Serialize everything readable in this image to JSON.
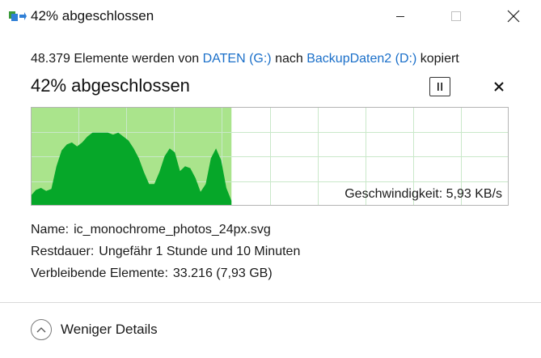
{
  "window": {
    "title": "42% abgeschlossen",
    "icon": "file-copy-icon"
  },
  "status": {
    "prefix": "48.379 Elemente werden von ",
    "source": "DATEN (G:)",
    "middle": " nach ",
    "destination": "BackupDaten2 (D:)",
    "suffix": " kopiert"
  },
  "progress": {
    "heading": "42% abgeschlossen",
    "percent": 42,
    "speed_label": "Geschwindigkeit: 5,93 KB/s",
    "speed_history": [
      0.1,
      0.16,
      0.18,
      0.15,
      0.17,
      0.4,
      0.56,
      0.62,
      0.64,
      0.6,
      0.64,
      0.7,
      0.74,
      0.74,
      0.74,
      0.74,
      0.72,
      0.74,
      0.7,
      0.66,
      0.58,
      0.48,
      0.34,
      0.22,
      0.22,
      0.34,
      0.5,
      0.58,
      0.54,
      0.35,
      0.4,
      0.38,
      0.28,
      0.14,
      0.22,
      0.48,
      0.58,
      0.46,
      0.18,
      0.05
    ],
    "colors": {
      "fill_area": "#aae48c",
      "curve": "#06a729",
      "grid": "#c9e8c9",
      "border": "#b5b5b5"
    }
  },
  "details": {
    "name_label": "Name:",
    "name_value": "ic_monochrome_photos_24px.svg",
    "remaining_label": "Restdauer:",
    "remaining_value": "Ungefähr 1 Stunde und 10 Minuten",
    "items_label": "Verbleibende Elemente:",
    "items_value": "33.216 (7,93 GB)"
  },
  "footer": {
    "less_details_label": "Weniger Details"
  }
}
